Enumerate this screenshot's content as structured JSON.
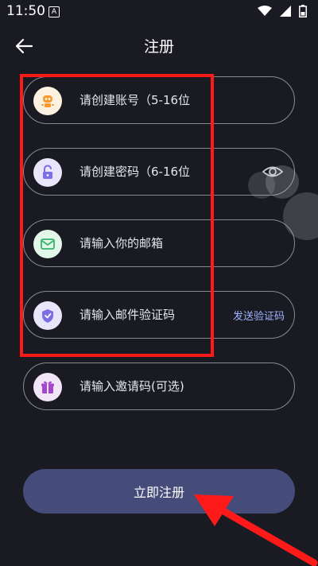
{
  "status": {
    "time": "11:50",
    "badge": "A"
  },
  "header": {
    "title": "注册"
  },
  "fields": {
    "account": {
      "placeholder": "请创建账号（5-16位"
    },
    "password": {
      "placeholder": "请创建密码（6-16位"
    },
    "email": {
      "placeholder": "请输入你的邮箱"
    },
    "code": {
      "placeholder": "请输入邮件验证码",
      "send_label": "发送验证码"
    },
    "invite": {
      "placeholder": "请输入邀请码(可选)"
    }
  },
  "actions": {
    "register_label": "立即注册"
  },
  "colors": {
    "background": "#1a1a22",
    "button": "#454c7a",
    "highlight": "#ff1a1a",
    "link": "#9fb4ff"
  }
}
